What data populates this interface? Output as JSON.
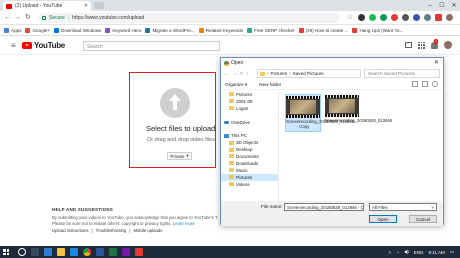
{
  "browser": {
    "tab_title": "(2) Upload - YouTube",
    "url_secure": "Secure",
    "url": "https://www.youtube.com/upload",
    "bookmarks": [
      {
        "label": "Apps",
        "color": "#4a7fe0"
      },
      {
        "label": "Google+",
        "color": "#dd4b39"
      },
      {
        "label": "Download Windows",
        "color": "#0078d7"
      },
      {
        "label": "Keyword Hero",
        "color": "#7e57c2"
      },
      {
        "label": "Migrate a WordPre...",
        "color": "#21759b"
      },
      {
        "label": "Related Keywords",
        "color": "#f57c00"
      },
      {
        "label": "Free SERP checker",
        "color": "#26a69a"
      },
      {
        "label": "(29) How to create ...",
        "color": "#e53935"
      },
      {
        "label": "Hang Ups (Want Yo...",
        "color": "#e53935"
      }
    ]
  },
  "youtube": {
    "logo_text": "YouTube",
    "search_placeholder": "Search",
    "notification_count": "2",
    "upload": {
      "title": "Select files to upload",
      "subtitle": "Or drag and drop video files",
      "privacy": "Private"
    },
    "help": {
      "title": "HELP AND SUGGESTIONS",
      "line1": "By submitting your videos to YouTube, you acknowledge that you agree to YouTube's T",
      "line2_prefix": "Please be sure not to violate others' copyright or privacy rights.",
      "learn_more": "Learn more",
      "links": [
        "Upload instructions",
        "Troubleshooting",
        "Mobile uploads"
      ]
    }
  },
  "dialog": {
    "title": "Open",
    "path": [
      "Pictures",
      "Saved Pictures"
    ],
    "search_placeholder": "Search Saved Pictures",
    "organize": "Organize",
    "new_folder": "New folder",
    "nav_items": [
      {
        "label": "Pictures",
        "icon": "folder-icon"
      },
      {
        "label": "2001-09",
        "icon": "folder-icon"
      },
      {
        "label": "Logos",
        "icon": "folder-icon"
      },
      {
        "label": "",
        "icon": ""
      },
      {
        "label": "OneDrive",
        "icon": "cloud-icon"
      },
      {
        "label": "",
        "icon": ""
      },
      {
        "label": "This PC",
        "icon": "pc-icon"
      },
      {
        "label": "3D Objects",
        "icon": "folder-icon"
      },
      {
        "label": "Desktop",
        "icon": "folder-icon"
      },
      {
        "label": "Documents",
        "icon": "folder-icon"
      },
      {
        "label": "Downloads",
        "icon": "folder-icon"
      },
      {
        "label": "Music",
        "icon": "folder-icon"
      },
      {
        "label": "Pictures",
        "icon": "folder-icon"
      },
      {
        "label": "Videos",
        "icon": "folder-icon"
      }
    ],
    "files": [
      {
        "name": "Screenrecording_20180528_013946 - Copy"
      },
      {
        "name": "Screenrecording_20180528_013946"
      }
    ],
    "file_name_label": "File name:",
    "file_name_value": "Screenrecording_20180528_013946 - C",
    "file_type": "All Files",
    "open_label": "Open",
    "cancel_label": "Cancel"
  },
  "taskbar": {
    "lang": "ENG",
    "time": "9:11 AM"
  }
}
